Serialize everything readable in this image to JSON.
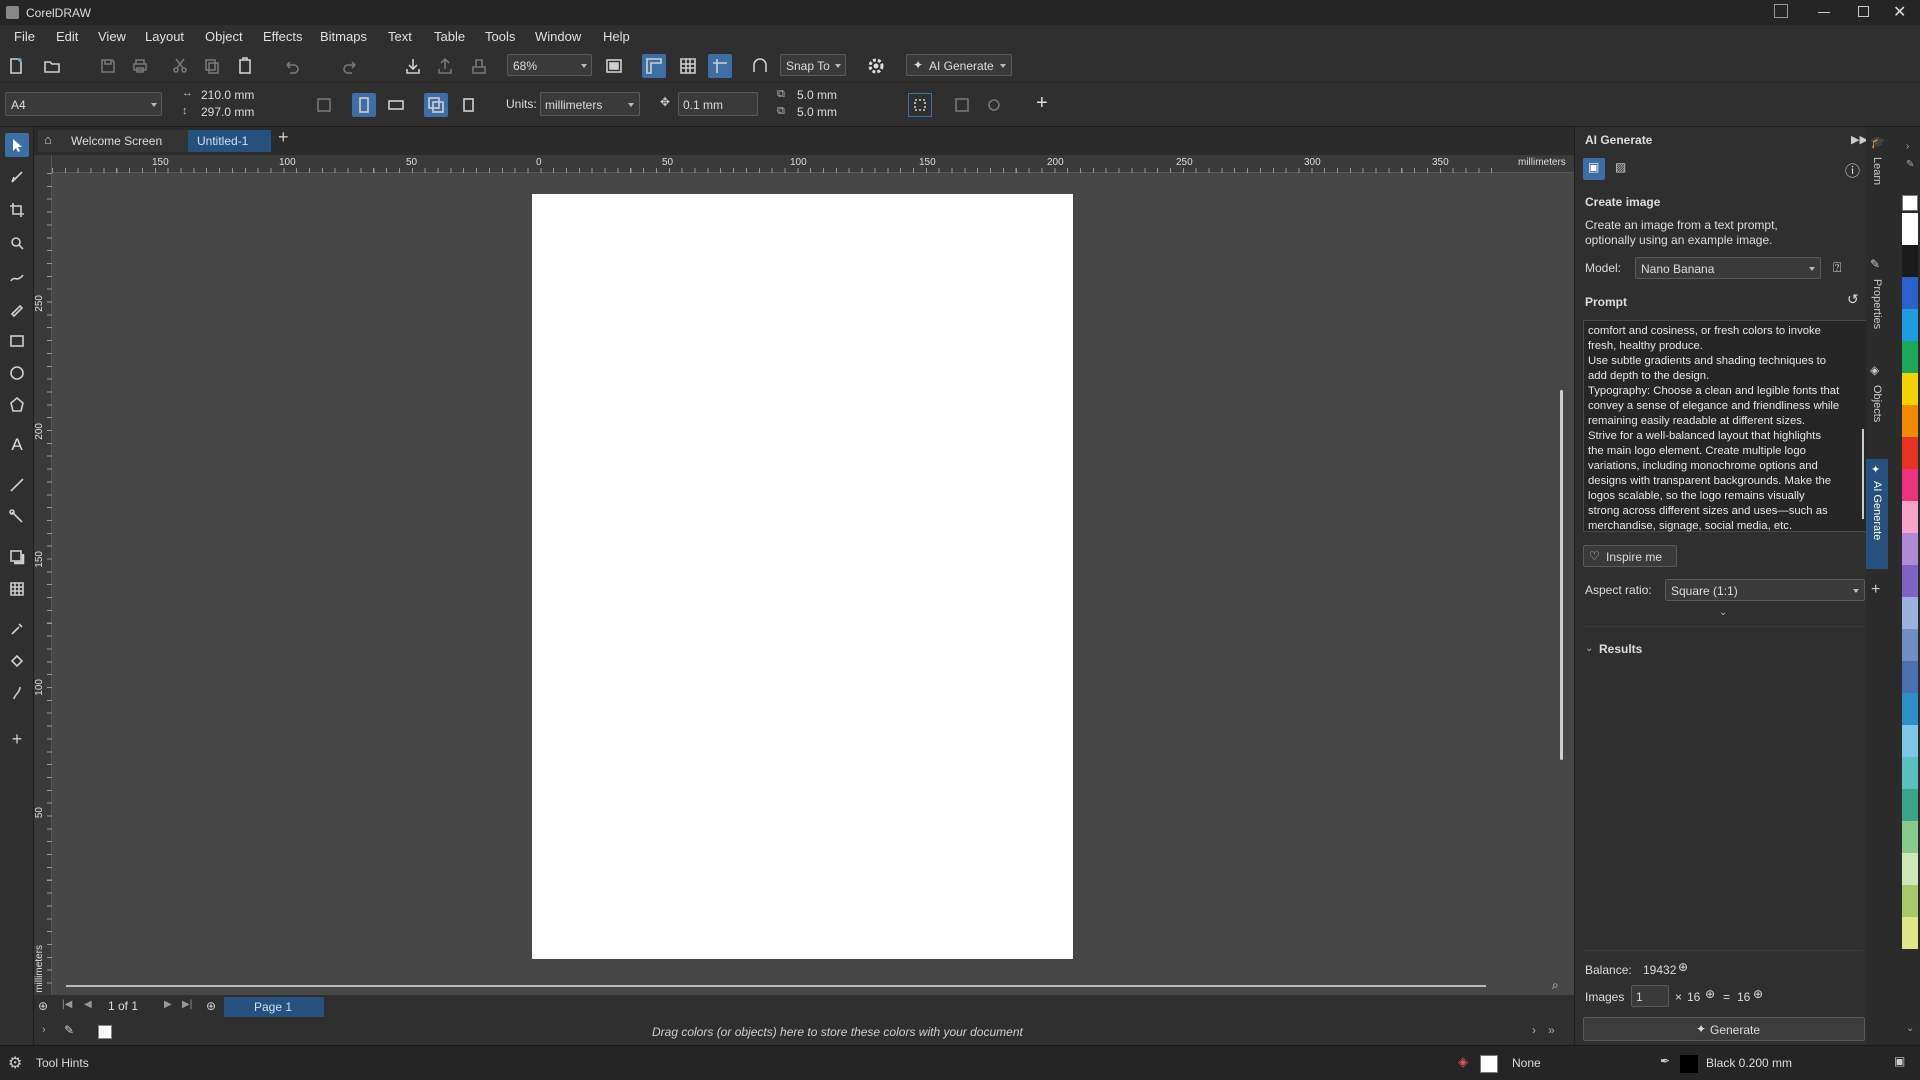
{
  "app": {
    "title": "CorelDRAW"
  },
  "menu": [
    "File",
    "Edit",
    "View",
    "Layout",
    "Object",
    "Effects",
    "Bitmaps",
    "Text",
    "Table",
    "Tools",
    "Window",
    "Help"
  ],
  "toolbar": {
    "zoom": "68%",
    "snap_label": "Snap To",
    "ai_label": "AI Generate"
  },
  "propbar": {
    "paper": "A4",
    "width": "210.0 mm",
    "height": "297.0 mm",
    "units_label": "Units:",
    "units": "millimeters",
    "nudge": "0.1 mm",
    "dup_x": "5.0 mm",
    "dup_y": "5.0 mm"
  },
  "doctabs": {
    "welcome": "Welcome Screen",
    "untitled": "Untitled-1"
  },
  "ruler": {
    "h_ticks": [
      "150",
      "100",
      "50",
      "0",
      "50",
      "100",
      "150",
      "200",
      "250",
      "300",
      "350"
    ],
    "unit": "millimeters",
    "v_ticks": [
      "250",
      "200",
      "150",
      "100",
      "50"
    ],
    "v_unit": "millimeters"
  },
  "pagenav": {
    "count": "1 of 1",
    "page_tab": "Page 1"
  },
  "colorbar": {
    "hint": "Drag colors (or objects) here to store these colors with your document"
  },
  "status": {
    "hints": "Tool Hints",
    "fill": "None",
    "outline": "Black 0.200 mm"
  },
  "panel": {
    "title": "AI Generate",
    "heading": "Create image",
    "desc": "Create an image from a text prompt, optionally using an example image.",
    "model_label": "Model:",
    "model": "Nano Banana",
    "prompt_label": "Prompt",
    "prompt_lines": [
      "comfort and cosiness, or fresh colors to invoke",
      "fresh, healthy produce.",
      "Use subtle gradients and shading techniques to",
      "add depth to the design.",
      "Typography: Choose a clean and legible fonts that",
      "convey a sense of elegance and friendliness while",
      "remaining easily readable at different sizes.",
      "Strive for a well-balanced layout that highlights",
      "the main logo element. Create multiple logo",
      "variations, including monochrome options and",
      "designs with transparent backgrounds. Make the",
      "logos scalable,  so the logo remains visually",
      "strong across different sizes and uses—such as",
      "merchandise, signage, social media, etc."
    ],
    "inspire": "Inspire me",
    "aspect_label": "Aspect ratio:",
    "aspect": "Square (1:1)",
    "results": "Results",
    "balance_label": "Balance:",
    "balance": "19432",
    "images_label": "Images",
    "images_count": "1",
    "x_sign": "×",
    "cost": "16",
    "eq_sign": "=",
    "total": "16",
    "generate": "Generate"
  },
  "sidetabs": [
    "Learn",
    "Properties",
    "Objects",
    "AI Generate"
  ],
  "palette": [
    "#ffffff",
    "#1a1a1a",
    "#2a62c9",
    "#1f9be0",
    "#1ea75b",
    "#f3d400",
    "#f08a00",
    "#e53222",
    "#e9337d",
    "#f7a4c8",
    "#b18ad6",
    "#7f63c4",
    "#9bb1de",
    "#6f8fc4",
    "#4c6fb0",
    "#2e8ec7",
    "#7fc5e8",
    "#5bbfbf",
    "#3aa38a",
    "#86c98a",
    "#cfe6b7",
    "#a7c96a",
    "#dfe68a"
  ]
}
